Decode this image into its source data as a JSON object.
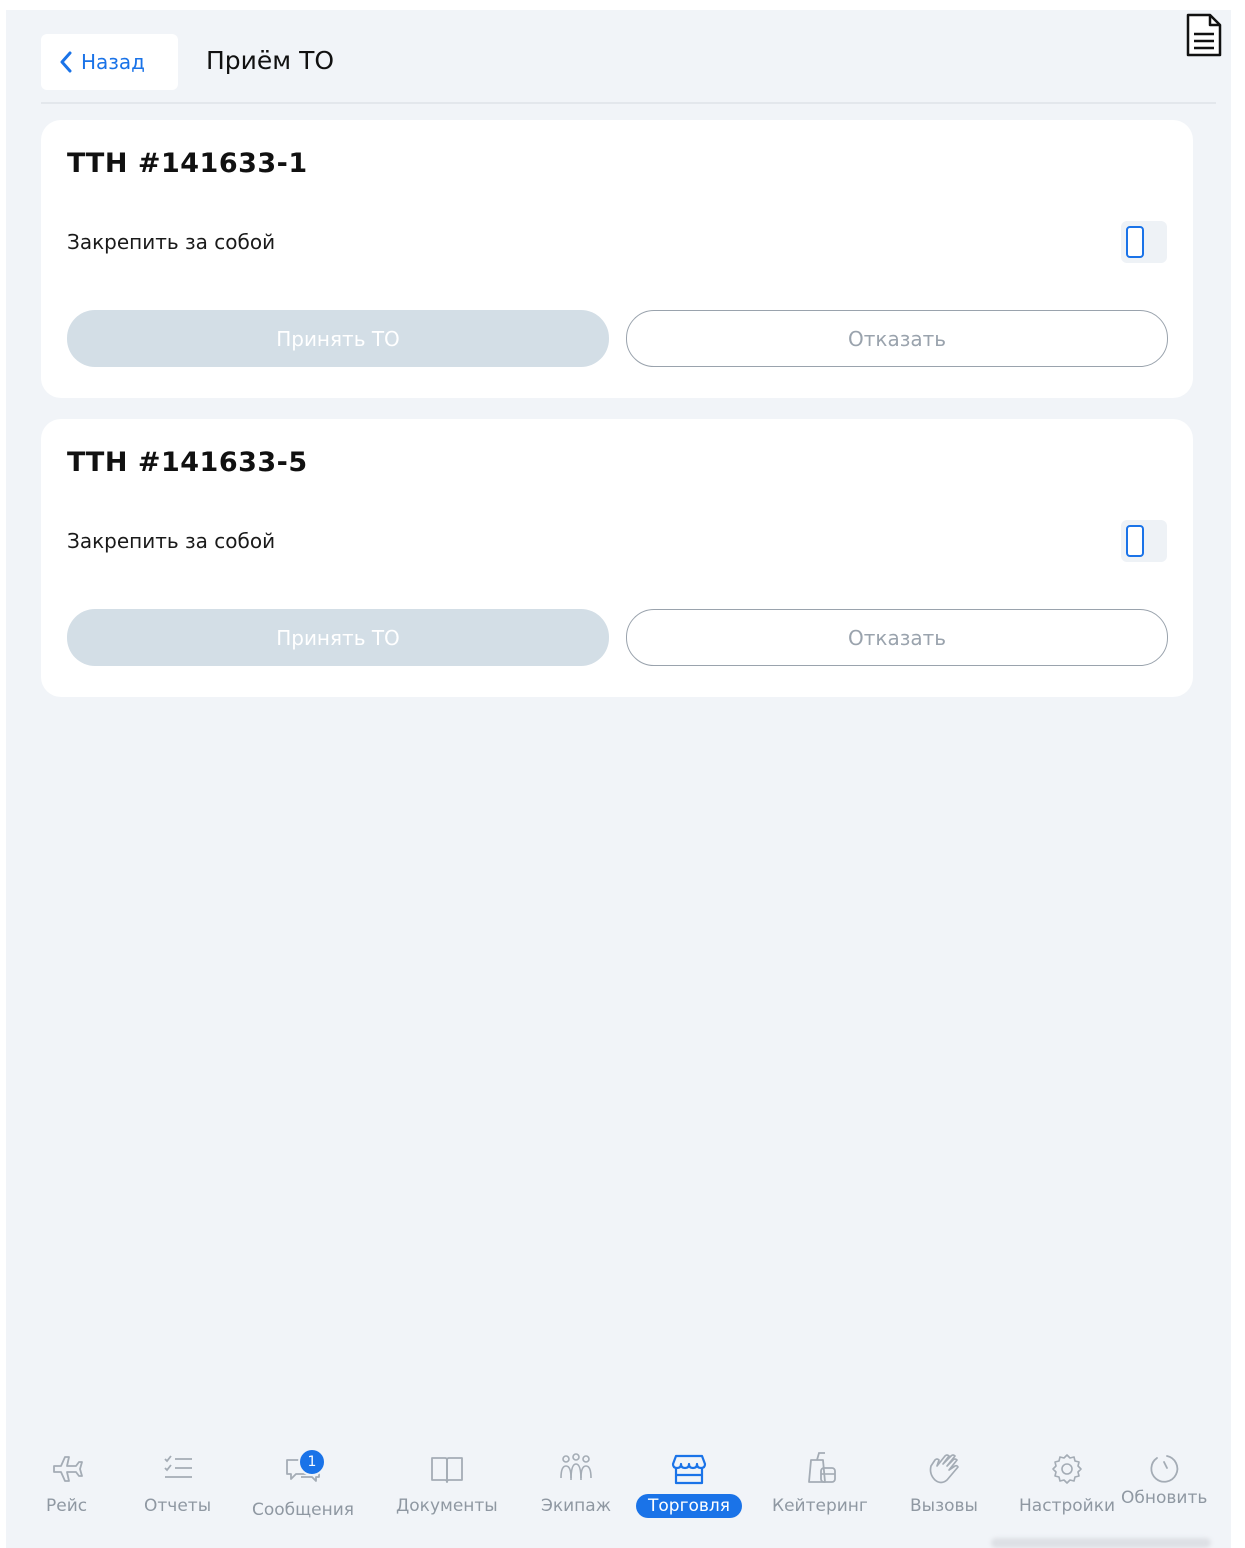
{
  "header": {
    "back_label": "Назад",
    "title": "Приём ТО"
  },
  "cards": [
    {
      "title": "ТТН #141633-1",
      "pin_label": "Закрепить за собой",
      "accept_label": "Принять ТО",
      "reject_label": "Отказать",
      "pinned": false
    },
    {
      "title": "ТТН #141633-5",
      "pin_label": "Закрепить за собой",
      "accept_label": "Принять ТО",
      "reject_label": "Отказать",
      "pinned": false
    }
  ],
  "tabbar": {
    "tabs": [
      {
        "label": "Рейс",
        "icon": "airplane-icon"
      },
      {
        "label": "Отчеты",
        "icon": "checklist-icon"
      },
      {
        "label": "Сообщения",
        "icon": "chat-icon",
        "badge": "1"
      },
      {
        "label": "Документы",
        "icon": "book-icon"
      },
      {
        "label": "Экипаж",
        "icon": "crew-icon"
      },
      {
        "label": "Торговля",
        "icon": "shop-icon",
        "active": true
      },
      {
        "label": "Кейтеринг",
        "icon": "catering-icon"
      },
      {
        "label": "Вызовы",
        "icon": "hand-wave-icon"
      },
      {
        "label": "Настройки",
        "icon": "gear-icon"
      }
    ],
    "refresh_label": "Обновить"
  },
  "colors": {
    "accent": "#1a73e8",
    "background": "#f1f4f8",
    "card": "#ffffff",
    "disabled_button": "#d3dee6",
    "inactive": "#8f98a2"
  }
}
